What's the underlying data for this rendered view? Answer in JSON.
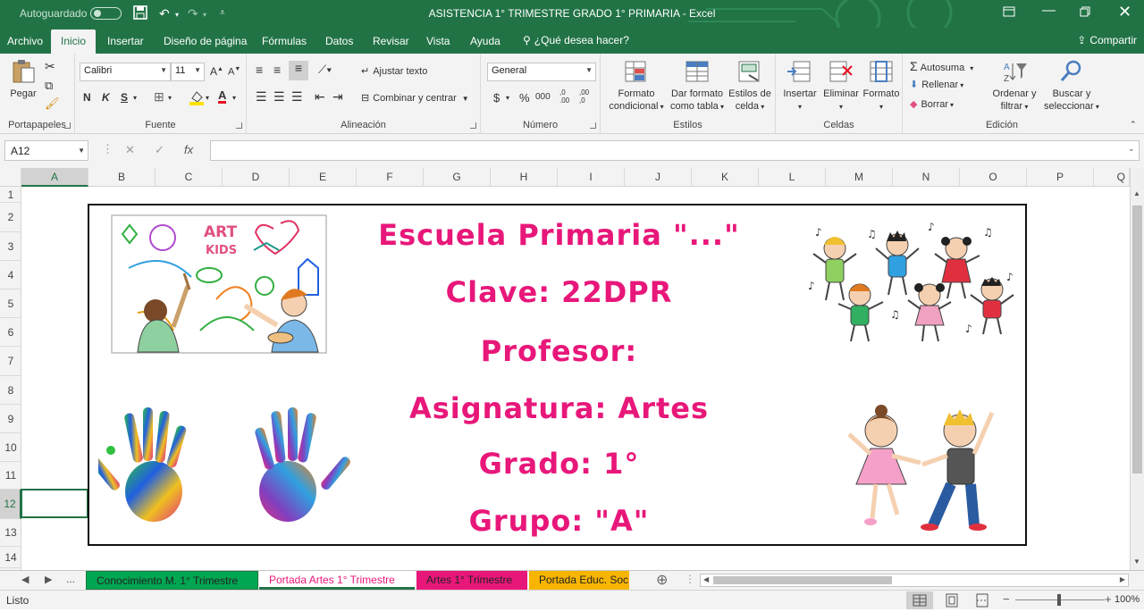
{
  "titlebar": {
    "autosave": "Autoguardado",
    "title": "ASISTENCIA 1° TRIMESTRE GRADO 1° PRIMARIA  -  Excel"
  },
  "ribbon_tabs": [
    "Archivo",
    "Inicio",
    "Insertar",
    "Diseño de página",
    "Fórmulas",
    "Datos",
    "Revisar",
    "Vista",
    "Ayuda"
  ],
  "tell_me": "¿Qué desea hacer?",
  "share": "Compartir",
  "clipboard": {
    "paste": "Pegar",
    "label": "Portapapeles"
  },
  "font": {
    "name": "Calibri",
    "size": "11",
    "bold": "N",
    "italic": "K",
    "underline": "S",
    "color_a": "A",
    "label": "Fuente"
  },
  "alignment": {
    "wrap": "Ajustar texto",
    "merge": "Combinar y centrar",
    "label": "Alineación"
  },
  "number": {
    "format": "General",
    "currency": "$",
    "percent": "%",
    "thousands": "000",
    "inc_dec": ",0 .00",
    "dec_dec": ",00 ,0",
    "label": "Número"
  },
  "styles": {
    "cond_line1": "Formato",
    "cond_line2": "condicional",
    "table_line1": "Dar formato",
    "table_line2": "como tabla",
    "cell_line1": "Estilos de",
    "cell_line2": "celda",
    "label": "Estilos"
  },
  "cells": {
    "insert": "Insertar",
    "delete": "Eliminar",
    "format": "Formato",
    "label": "Celdas"
  },
  "editing": {
    "autosum": "Autosuma",
    "fill": "Rellenar",
    "clear": "Borrar",
    "sort_line1": "Ordenar y",
    "sort_line2": "filtrar",
    "find_line1": "Buscar y",
    "find_line2": "seleccionar",
    "label": "Edición"
  },
  "formula_bar": {
    "name_box": "A12",
    "fx": "fx",
    "content": ""
  },
  "columns": [
    "A",
    "B",
    "C",
    "D",
    "E",
    "F",
    "G",
    "H",
    "I",
    "J",
    "K",
    "L",
    "M",
    "N",
    "O",
    "P",
    "Q"
  ],
  "rows": [
    "1",
    "2",
    "3",
    "4",
    "5",
    "6",
    "7",
    "8",
    "9",
    "10",
    "11",
    "12",
    "13",
    "14"
  ],
  "selected": {
    "column": "A",
    "row": "12"
  },
  "cover": {
    "line1": "Escuela Primaria \"...\"",
    "line2": "Clave: 22DPR",
    "line3": "Profesor:",
    "line4": "Asignatura: Artes",
    "line5": "Grado: 1°",
    "line6": "Grupo: \"A\"",
    "art_sign_1": "ART",
    "art_sign_2": "KIDS"
  },
  "sheet_tabs": {
    "ellipsis": "...",
    "tab1": "Conocimiento M. 1° Trimestre",
    "tab2": "Portada Artes 1° Trimestre",
    "tab3": "Artes 1° Trimestre",
    "tab4": "Portada Educ. Soc"
  },
  "status": {
    "ready": "Listo",
    "zoom": "100%"
  },
  "colors": {
    "excel_green": "#217346",
    "title_pink": "#e8177a",
    "tab1": "#00a651",
    "tab3": "#e8177a",
    "tab4": "#f7b500"
  }
}
